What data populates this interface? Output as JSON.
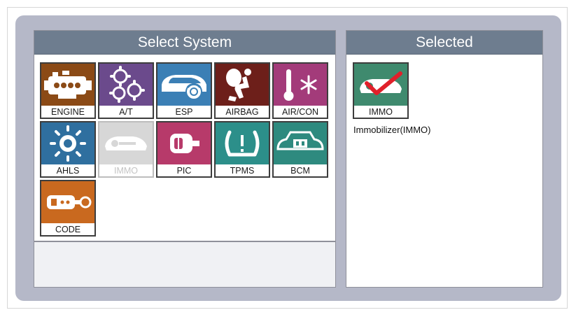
{
  "left_panel": {
    "title": "Select System"
  },
  "right_panel": {
    "title": "Selected"
  },
  "systems": [
    {
      "label": "ENGINE",
      "color": "#8b4a16",
      "icon": "engine-icon"
    },
    {
      "label": "A/T",
      "color": "#6b4a8c",
      "icon": "gears-icon"
    },
    {
      "label": "ESP",
      "color": "#3b7fb5",
      "icon": "car-brake-icon"
    },
    {
      "label": "AIRBAG",
      "color": "#6d1f1a",
      "icon": "airbag-icon"
    },
    {
      "label": "AIR/CON",
      "color": "#a33b7a",
      "icon": "thermometer-snowflake-icon"
    },
    {
      "label": "AHLS",
      "color": "#2f6f9f",
      "icon": "headlamp-icon"
    },
    {
      "label": "IMMO",
      "color": "#d7d7d7",
      "icon": "key-icon",
      "disabled": true
    },
    {
      "label": "PIC",
      "color": "#b73a6a",
      "icon": "smart-key-icon"
    },
    {
      "label": "TPMS",
      "color": "#2c8f8a",
      "icon": "tire-pressure-icon"
    },
    {
      "label": "BCM",
      "color": "#2e8a7f",
      "icon": "body-control-icon"
    },
    {
      "label": "CODE",
      "color": "#c9691f",
      "icon": "remote-key-icon"
    }
  ],
  "selected": {
    "tile_label": "IMMO",
    "color": "#3f8a6e",
    "icon": "immobilizer-check-icon",
    "caption": "Immobilizer(IMMO)"
  }
}
